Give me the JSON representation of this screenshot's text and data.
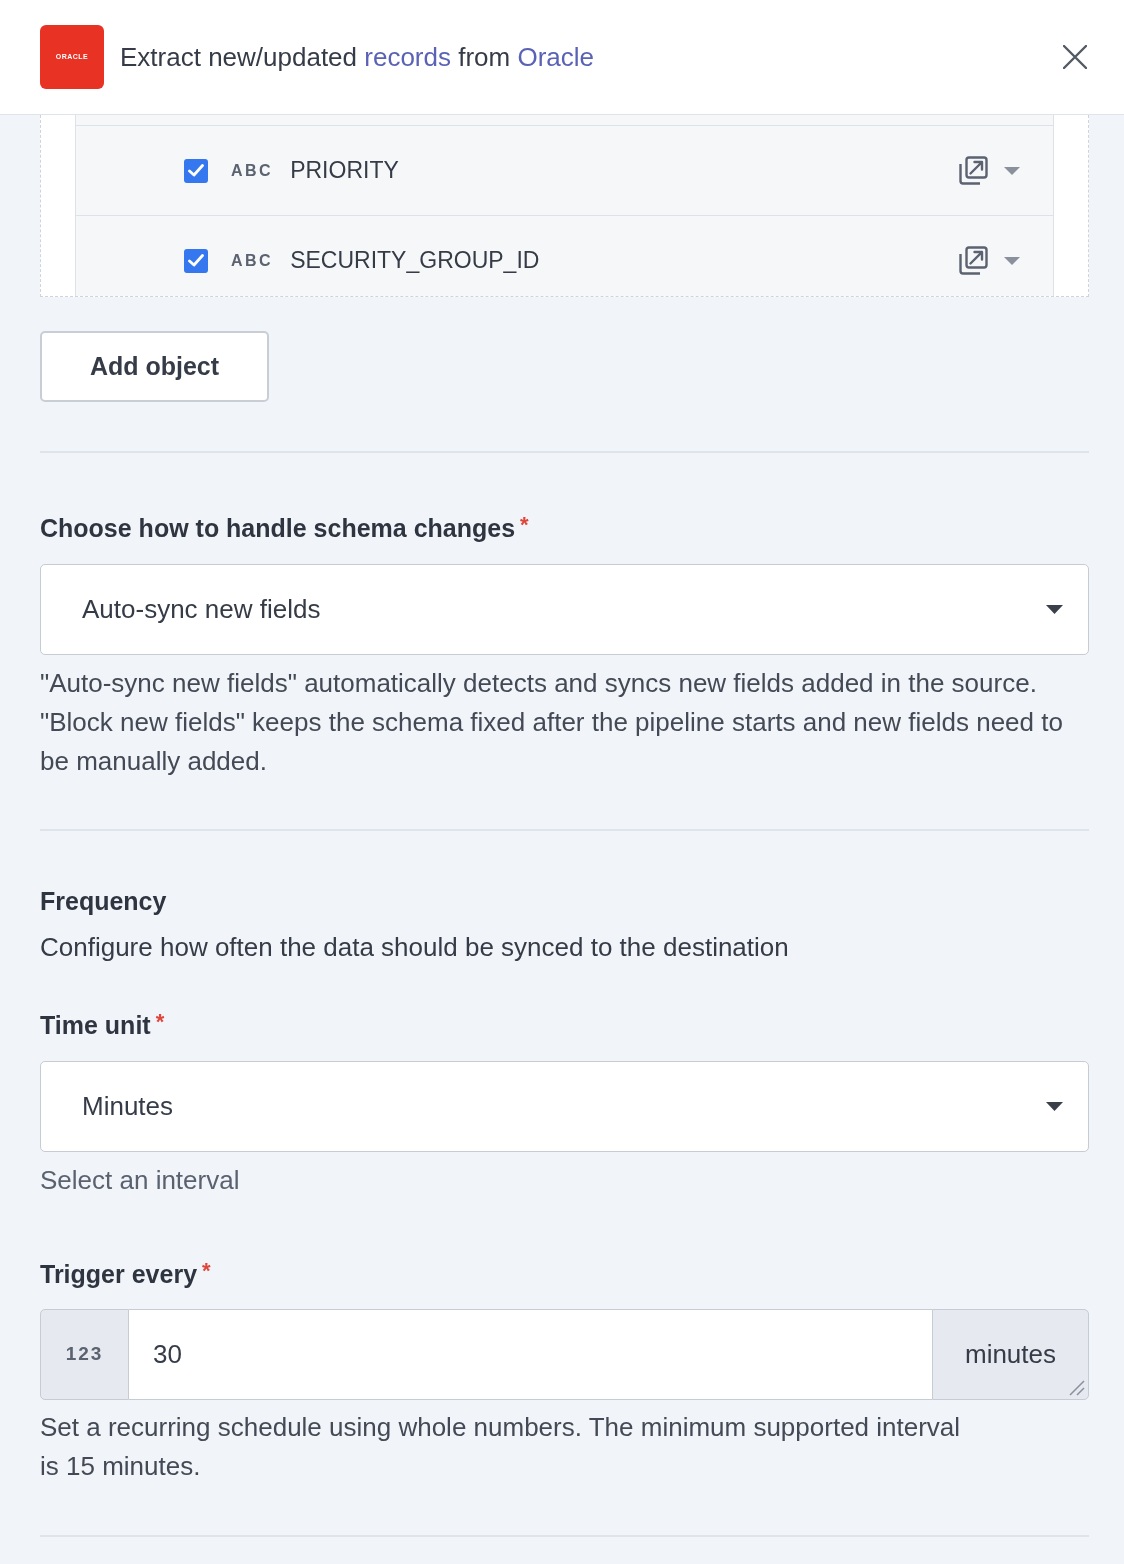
{
  "header": {
    "logo_text": "ORACLE",
    "title_parts": [
      {
        "kind": "text",
        "text": "Extract new/updated "
      },
      {
        "kind": "link",
        "text": "records"
      },
      {
        "kind": "text",
        "text": " from "
      },
      {
        "kind": "link",
        "text": "Oracle"
      }
    ]
  },
  "object_fields": [
    {
      "checked": true,
      "type_badge": "ABC",
      "name": "PRIORITY"
    },
    {
      "checked": true,
      "type_badge": "ABC",
      "name": "SECURITY_GROUP_ID"
    }
  ],
  "add_object_button": "Add object",
  "schema_changes": {
    "label": "Choose how to handle schema changes",
    "required_mark": "*",
    "value": "Auto-sync new fields",
    "help": "\"Auto-sync new fields\" automatically detects and syncs new fields added in the source. \"Block new fields\" keeps the schema fixed after the pipeline starts and new fields need to be manually added."
  },
  "frequency": {
    "title": "Frequency",
    "description": "Configure how often the data should be synced to the destination",
    "time_unit": {
      "label": "Time unit",
      "required_mark": "*",
      "value": "Minutes",
      "help": "Select an interval"
    },
    "trigger_every": {
      "label": "Trigger every",
      "required_mark": "*",
      "prefix": "123",
      "value": "30",
      "suffix": "minutes",
      "help": "Set a recurring schedule using whole numbers. The minimum supported interval is 15 minutes."
    }
  }
}
